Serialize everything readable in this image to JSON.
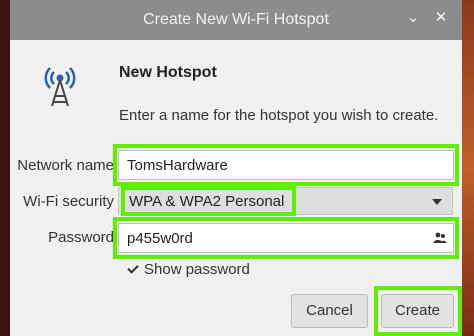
{
  "window": {
    "title": "Create New Wi-Fi Hotspot",
    "minimize_glyph": "⌄",
    "close_glyph": "✕"
  },
  "dialog": {
    "heading": "New Hotspot",
    "description": "Enter a name for the hotspot you wish to create.",
    "icon": "wifi-tower-icon"
  },
  "form": {
    "network_name_label": "Network name",
    "network_name_value": "TomsHardware",
    "security_label": "Wi-Fi security",
    "security_value": "WPA & WPA2 Personal",
    "password_label": "Password",
    "password_value": "p455w0rd",
    "password_icon": "people-icon",
    "show_password_label": "Show password",
    "show_password_checked": true
  },
  "buttons": {
    "cancel": "Cancel",
    "create": "Create"
  },
  "colors": {
    "highlight": "#5cf000",
    "titlebar": "#8c8c8c",
    "dialog_bg": "#f0f0f0"
  }
}
